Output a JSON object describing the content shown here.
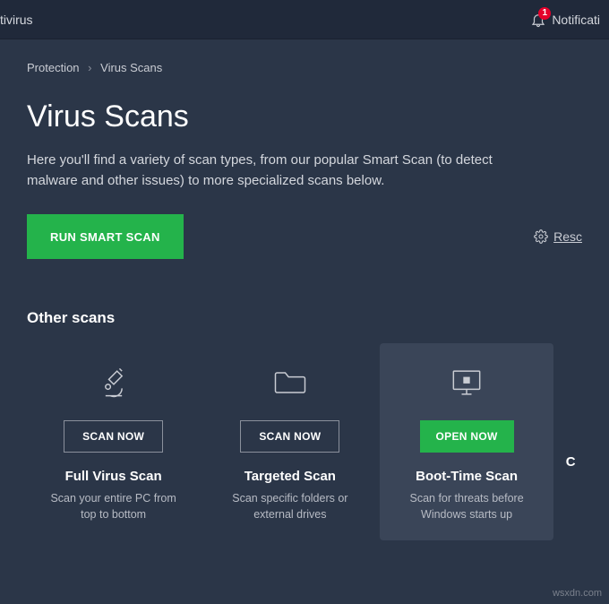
{
  "topbar": {
    "app_partial": "tivirus",
    "notif_label_partial": "Notificati",
    "notif_count": "1"
  },
  "breadcrumb": {
    "root": "Protection",
    "sep": "›",
    "leaf": "Virus Scans"
  },
  "page": {
    "title": "Virus Scans",
    "desc": "Here you'll find a variety of scan types, from our popular Smart Scan (to detect malware and other issues) to more specialized scans below."
  },
  "hero": {
    "cta": "RUN SMART SCAN",
    "rescan": "Resc"
  },
  "other": {
    "heading": "Other scans",
    "cards": [
      {
        "btn": "SCAN NOW",
        "title": "Full Virus Scan",
        "desc": "Scan your entire PC from top to bottom"
      },
      {
        "btn": "SCAN NOW",
        "title": "Targeted Scan",
        "desc": "Scan specific folders or external drives"
      },
      {
        "btn": "OPEN NOW",
        "title": "Boot-Time Scan",
        "desc": "Scan for threats before Windows starts up"
      }
    ],
    "partial_card_letter": "C"
  },
  "watermark": "wsxdn.com"
}
